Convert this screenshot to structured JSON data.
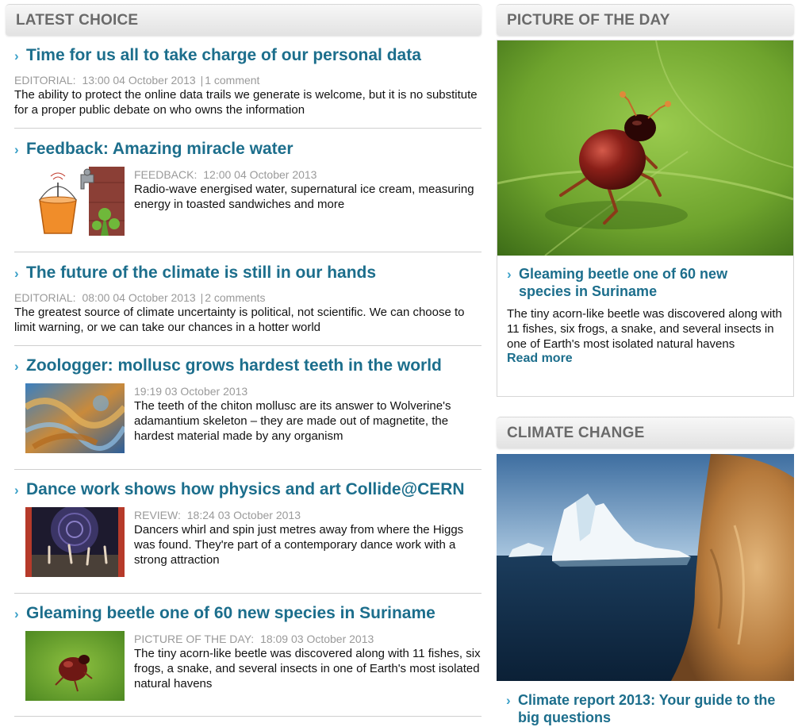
{
  "latest": {
    "header": "LATEST CHOICE",
    "articles": [
      {
        "title": "Time for us all to take charge of our personal data",
        "category": "EDITORIAL:",
        "time": "13:00 04 October 2013",
        "comments": "1 comment",
        "summary": "The ability to protect the online data trails we generate is welcome, but it is no substitute for a proper public debate on who owns the information"
      },
      {
        "title": "Feedback: Amazing miracle water",
        "category": "FEEDBACK:",
        "time": "12:00 04 October 2013",
        "summary": "Radio-wave energised water, supernatural ice cream, measuring energy in toasted sandwiches and more"
      },
      {
        "title": "The future of the climate is still in our hands",
        "category": "EDITORIAL:",
        "time": "08:00 04 October 2013",
        "comments": "2 comments",
        "summary": "The greatest source of climate uncertainty is political, not scientific. We can choose to limit warning, or we can take our chances in a hotter world"
      },
      {
        "title": "Zoologger: mollusc grows hardest teeth in the world",
        "time": "19:19 03 October 2013",
        "summary": "The teeth of the chiton mollusc are its answer to Wolverine's adamantium skeleton – they are made out of magnetite, the hardest material made by any organism"
      },
      {
        "title": "Dance work shows how physics and art Collide@CERN",
        "category": "REVIEW:",
        "time": "18:24 03 October 2013",
        "summary": "Dancers whirl and spin just metres away from where the Higgs was found. They're part of a contemporary dance work with a strong attraction"
      },
      {
        "title": "Gleaming beetle one of 60 new species in Suriname",
        "category": "PICTURE OF THE DAY:",
        "time": "18:09 03 October 2013",
        "summary": "The tiny acorn-like beetle was discovered along with 11 fishes, six frogs, a snake, and several insects in one of Earth's most isolated natural havens"
      }
    ]
  },
  "picture_of_day": {
    "header": "PICTURE OF THE DAY",
    "title": "Gleaming beetle one of 60 new species in Suriname",
    "summary": "The tiny acorn-like beetle was discovered along with 11 fishes, six frogs, a snake, and several insects in one of Earth's most isolated natural havens",
    "read_more": "Read more"
  },
  "climate": {
    "header": "CLIMATE CHANGE",
    "title": "Climate report 2013: Your guide to the big questions"
  },
  "colors": {
    "link": "#1c6e8c",
    "chevron": "#3aa0c8",
    "meta": "#9a9a9a",
    "header_text": "#6a6a6a"
  },
  "icons": {
    "chevron": "›"
  }
}
